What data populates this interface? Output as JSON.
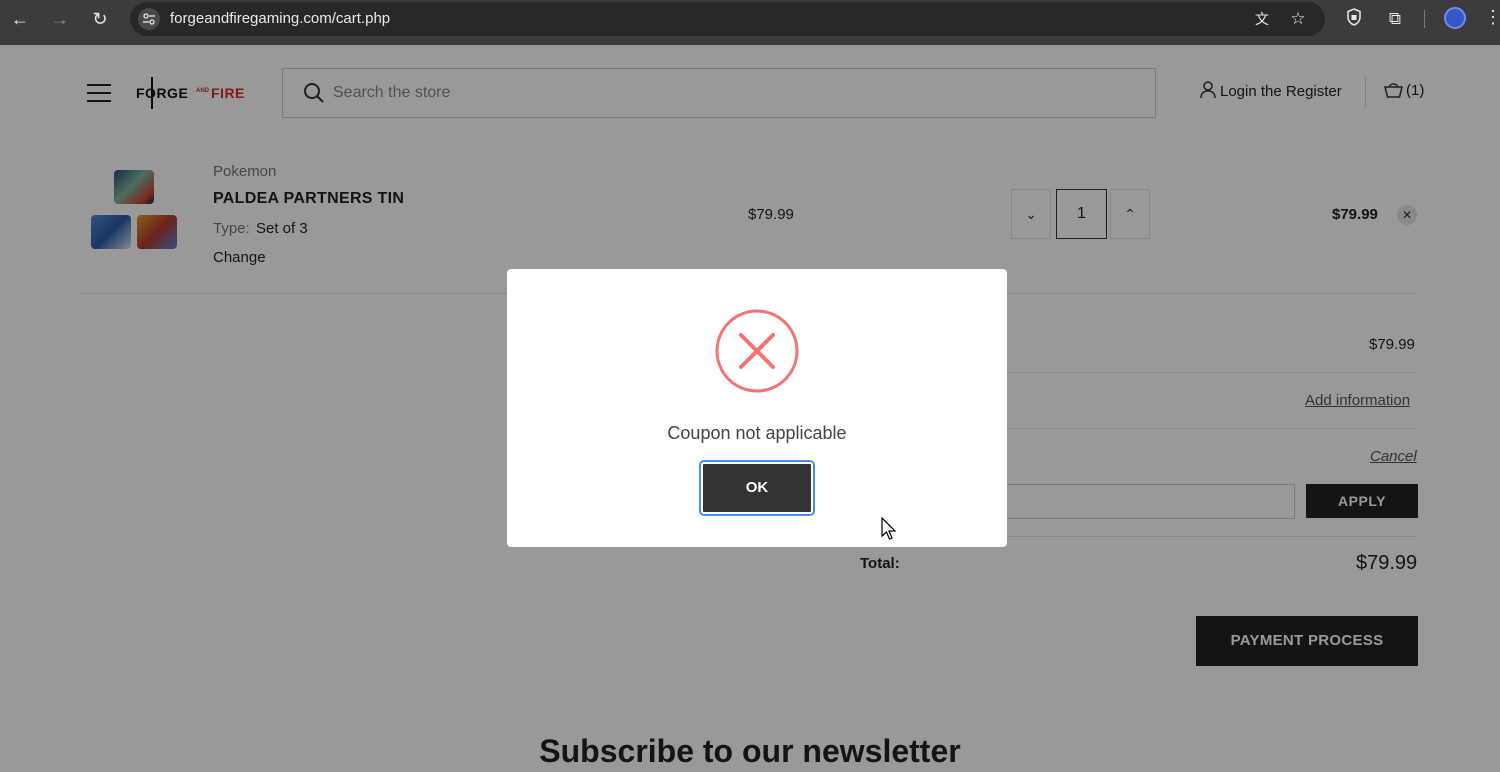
{
  "browser": {
    "url": "forgeandfiregaming.com/cart.php",
    "back_icon": "←",
    "forward_icon": "→",
    "reload_icon": "↻",
    "translate_icon": "文",
    "star_icon": "☆",
    "extensions_icon": "⧉",
    "menu_icon": "⋮"
  },
  "header": {
    "logo_forge": "FORGE",
    "logo_and": "AND",
    "logo_fire": "FIRE",
    "search_placeholder": "Search the store",
    "login_label": "Login the Register",
    "cart_label": "(1)"
  },
  "cart_item": {
    "brand": "Pokemon",
    "name": "PALDEA PARTNERS TIN",
    "type_label": "Type:",
    "type_value": "Set of 3",
    "change_label": "Change",
    "unit_price": "$79.99",
    "quantity": "1",
    "qty_dec_icon": "⌄",
    "qty_inc_icon": "⌃",
    "line_total": "$79.99",
    "remove_icon": "✕"
  },
  "summary": {
    "subtotal_value": "$79.99",
    "add_information_label": "Add information",
    "cancel_label": "Cancel",
    "apply_label": "APPLY",
    "total_label": "Total:",
    "total_value": "$79.99",
    "payment_label": "PAYMENT PROCESS"
  },
  "newsletter": {
    "title": "Subscribe to our newsletter"
  },
  "dialog": {
    "message": "Coupon not applicable",
    "ok_label": "OK",
    "icon_color": "#f27474"
  }
}
